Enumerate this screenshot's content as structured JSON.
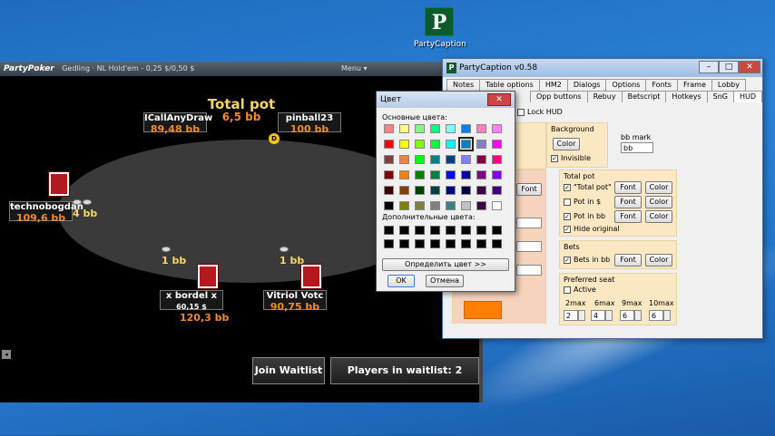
{
  "desktop_icon": {
    "glyph": "P",
    "label": "PartyCaption"
  },
  "poker": {
    "brand": "PartyPoker",
    "title": "Gedling · NL Hold'em - 0,25 $/0,50 $",
    "menu": "Menu ▾",
    "total_pot_label": "Total pot",
    "total_pot_value": "6,5 bb",
    "seats": [
      {
        "name": "ICallAnyDraw",
        "sub": "89,48 bb"
      },
      {
        "name": "pinball23",
        "sub": "100 bb"
      },
      {
        "name": "technobogdan",
        "sub": "109,6 bb"
      },
      {
        "name": "x bordel x",
        "sub": "60,15 $",
        "below": "120,3 bb"
      },
      {
        "name": "Vitriol Votc",
        "sub": "90,75 bb"
      }
    ],
    "bets": [
      "4 bb",
      "1 bb",
      "1 bb"
    ],
    "dealer": "D",
    "join_waitlist": "Join Waitlist",
    "players_in_waitlist": "Players in waitlist: 2"
  },
  "color_dialog": {
    "title": "Цвет",
    "basic_label": "Основные цвета:",
    "custom_label": "Дополнительные цвета:",
    "define_button": "Определить цвет >>",
    "ok": "OK",
    "cancel": "Отмена",
    "basic_colors": [
      "#ff8080",
      "#ffff80",
      "#80ff80",
      "#00ff80",
      "#80ffff",
      "#0080ff",
      "#ff80c0",
      "#ff80ff",
      "#ff0000",
      "#ffff00",
      "#80ff00",
      "#00ff40",
      "#00ffff",
      "#0080c0",
      "#8080c0",
      "#ff00ff",
      "#804040",
      "#ff8040",
      "#00ff00",
      "#008080",
      "#004080",
      "#8080ff",
      "#800040",
      "#ff0080",
      "#800000",
      "#ff8000",
      "#008000",
      "#008040",
      "#0000ff",
      "#0000a0",
      "#800080",
      "#8000ff",
      "#400000",
      "#804000",
      "#004000",
      "#004040",
      "#000080",
      "#000040",
      "#400040",
      "#400080",
      "#000000",
      "#808000",
      "#808040",
      "#808080",
      "#408080",
      "#c0c0c0",
      "#400040",
      "#ffffff"
    ],
    "selected_index": 13
  },
  "party_caption": {
    "title": "PartyCaption v0.58",
    "tabs_row1": [
      "Notes",
      "Table options",
      "HM2",
      "Dialogs",
      "Options",
      "Fonts",
      "Frame",
      "Lobby"
    ],
    "tabs_row2": [
      "Opp buttons",
      "Rebuy",
      "Betscript",
      "Hotkeys",
      "SnG",
      "HUD"
    ],
    "lock_hud": "Lock HUD",
    "background_label": "Background",
    "color_btn": "Color",
    "invisible": "Invisible",
    "bb_mark_label": "bb mark",
    "bb_mark_value": "bb",
    "font_btn": "Font",
    "total_pot_group": "Total pot",
    "tp_total": "\"Total pot\"",
    "tp_dollar": "Pot in $",
    "tp_bb": "Pot in bb",
    "tp_hide": "Hide original",
    "bets_group": "Bets",
    "bets_in_bb": "Bets in bb",
    "pref_seat_group": "Preferred seat",
    "active": "Active",
    "max_labels": [
      "2max",
      "6max",
      "9max",
      "10max"
    ],
    "max_values": [
      "2",
      "4",
      "6",
      "6"
    ],
    "accent_color": "#ff7f00"
  }
}
